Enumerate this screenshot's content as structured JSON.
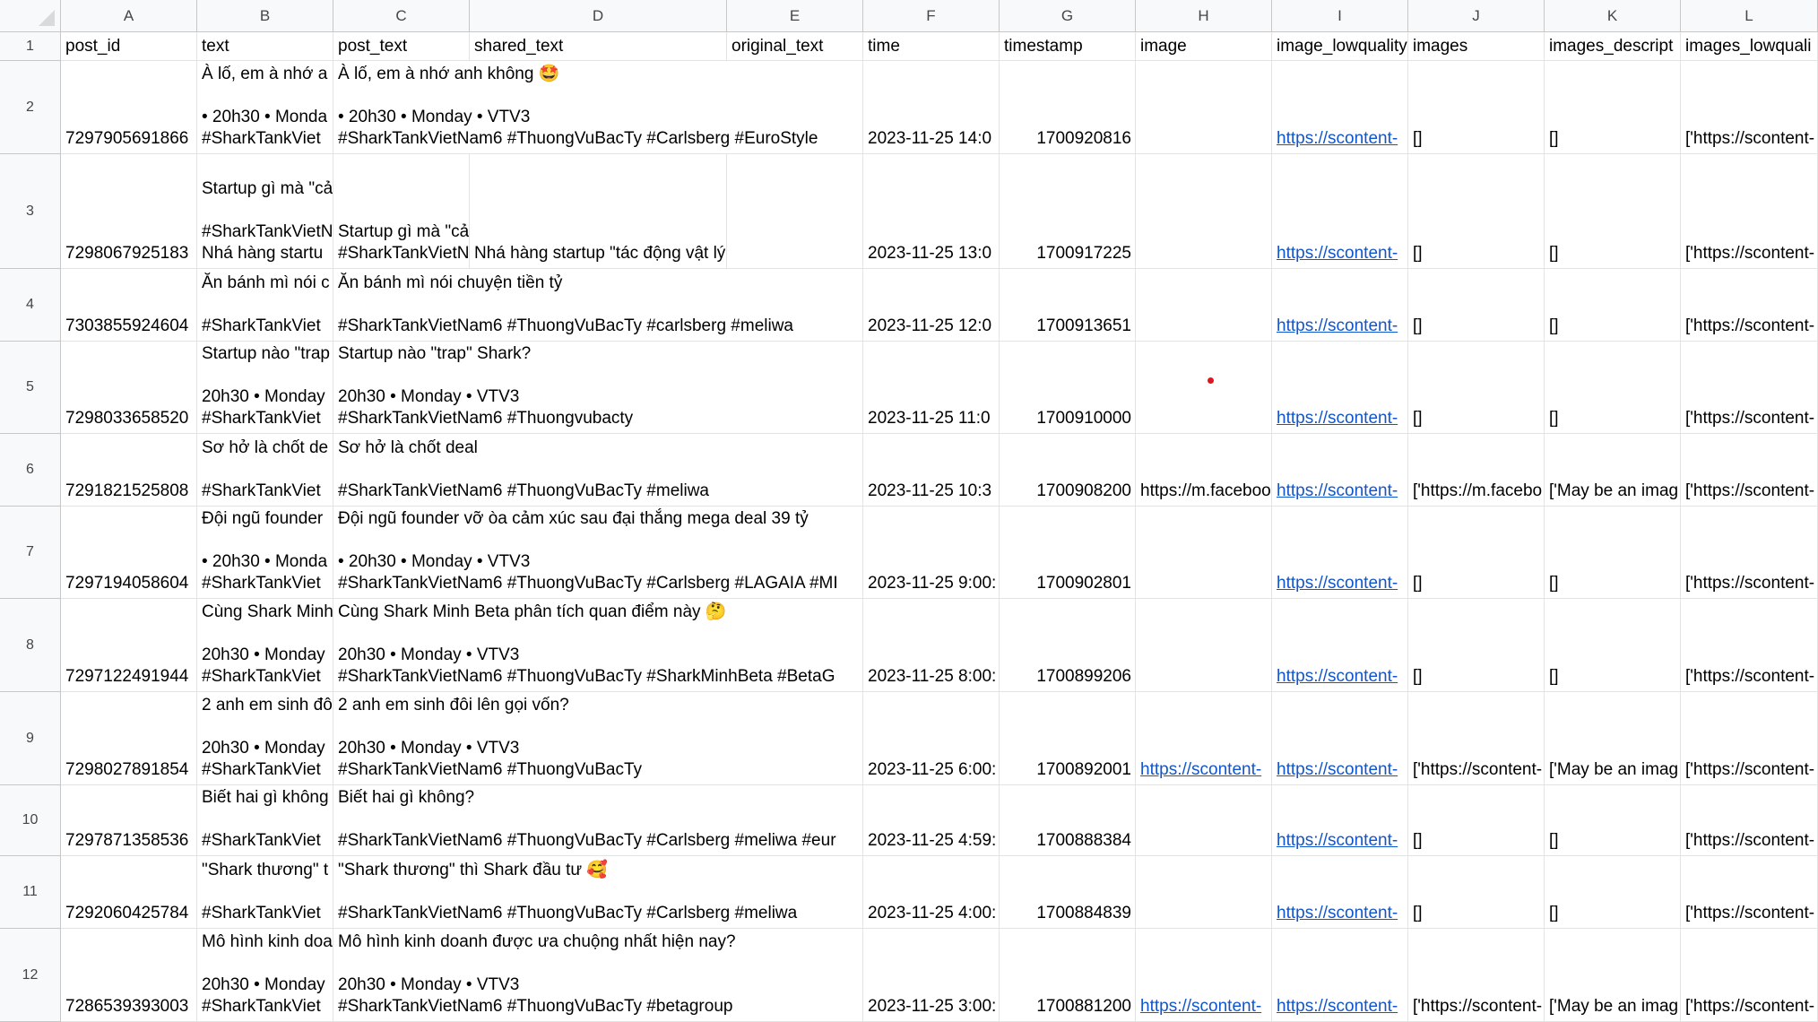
{
  "columns": [
    "A",
    "B",
    "C",
    "D",
    "E",
    "F",
    "G",
    "H",
    "I",
    "J",
    "K",
    "L"
  ],
  "header_row_number": "1",
  "headers": [
    "post_id",
    "text",
    "post_text",
    "shared_text",
    "original_text",
    "time",
    "timestamp",
    "image",
    "image_lowquality",
    "images",
    "images_descript",
    "images_lowquali"
  ],
  "rows": [
    {
      "num": "2",
      "post_id": "7297905691866",
      "text": "À lố, em à nhớ a\n\n• 20h30 • Monda\n#SharkTankViet",
      "post_text": "À lố, em à nhớ anh không 🤩\n\n• 20h30 • Monday • VTV3\n#SharkTankVietNam6 #ThuongVuBacTy #Carlsberg #EuroStyle",
      "shared_text": "",
      "original_text": "",
      "time": "2023-11-25 14:0",
      "timestamp": "1700920816",
      "image": "",
      "image_lowquality": "https://scontent-",
      "images": "[]",
      "images_descript": "[]",
      "images_lowquali": "['https://scontent-"
    },
    {
      "num": "3",
      "post_id": "7298067925183",
      "text": "Startup gì mà \"cả\n\n#SharkTankVietN\nNhá hàng startu",
      "post_text": "\n\nStartup gì mà \"cả\n#SharkTankVietN",
      "shared_text": "Nhá hàng startup \"tác động vật lý\" ngay tại trườn",
      "original_text": "",
      "time": "2023-11-25 13:0",
      "timestamp": "1700917225",
      "image": "",
      "image_lowquality": "https://scontent-",
      "images": "[]",
      "images_descript": "[]",
      "images_lowquali": "['https://scontent-"
    },
    {
      "num": "4",
      "post_id": "7303855924604",
      "text": "Ăn bánh mì nói c\n\n#SharkTankViet",
      "post_text": "Ăn bánh mì nói chuyện tiền tỷ\n\n#SharkTankVietNam6 #ThuongVuBacTy #carlsberg #meliwa",
      "shared_text": "",
      "original_text": "",
      "time": "2023-11-25 12:0",
      "timestamp": "1700913651",
      "image": "",
      "image_lowquality": "https://scontent-",
      "images": "[]",
      "images_descript": "[]",
      "images_lowquali": "['https://scontent-"
    },
    {
      "num": "5",
      "post_id": "7298033658520",
      "text": "Startup nào \"trap\n\n20h30 • Monday\n#SharkTankViet",
      "post_text": "Startup nào \"trap\" Shark?\n\n20h30 • Monday • VTV3\n#SharkTankVietNam6 #Thuongvubacty",
      "shared_text": "",
      "original_text": "",
      "time": "2023-11-25 11:0",
      "timestamp": "1700910000",
      "image": "",
      "image_lowquality": "https://scontent-",
      "images": "[]",
      "images_descript": "[]",
      "images_lowquali": "['https://scontent-"
    },
    {
      "num": "6",
      "post_id": "7291821525808",
      "text": "Sơ hở là chốt de\n\n#SharkTankViet",
      "post_text": "Sơ hở là chốt deal\n\n#SharkTankVietNam6 #ThuongVuBacTy #meliwa",
      "shared_text": "",
      "original_text": "",
      "time": "2023-11-25 10:3",
      "timestamp": "1700908200",
      "image": "https://m.faceboo",
      "image_lowquality": "https://scontent-",
      "images": "['https://m.facebo",
      "images_descript": "['May be an imag",
      "images_lowquali": "['https://scontent-"
    },
    {
      "num": "7",
      "post_id": "7297194058604",
      "text": "Đội ngũ founder\n\n• 20h30 • Monda\n#SharkTankViet",
      "post_text": "Đội ngũ founder vỡ òa cảm xúc sau đại thắng mega deal 39 tỷ\n\n• 20h30 • Monday • VTV3\n#SharkTankVietNam6 #ThuongVuBacTy #Carlsberg #LAGAIA #MI",
      "shared_text": "",
      "original_text": "",
      "time": "2023-11-25 9:00:",
      "timestamp": "1700902801",
      "image": "",
      "image_lowquality": "https://scontent-",
      "images": "[]",
      "images_descript": "[]",
      "images_lowquali": "['https://scontent-"
    },
    {
      "num": "8",
      "post_id": "7297122491944",
      "text": "Cùng Shark Minh\n\n20h30 • Monday\n#SharkTankViet",
      "post_text": "Cùng Shark Minh Beta phân tích quan điểm này 🤔\n\n20h30 • Monday • VTV3\n#SharkTankVietNam6 #ThuongVuBacTy #SharkMinhBeta #BetaG",
      "shared_text": "",
      "original_text": "",
      "time": "2023-11-25 8:00:",
      "timestamp": "1700899206",
      "image": "",
      "image_lowquality": "https://scontent-",
      "images": "[]",
      "images_descript": "[]",
      "images_lowquali": "['https://scontent-"
    },
    {
      "num": "9",
      "post_id": "7298027891854",
      "text": "2 anh em sinh đô\n\n20h30 • Monday\n#SharkTankViet",
      "post_text": "2 anh em sinh đôi lên gọi vốn?\n\n20h30 • Monday • VTV3\n#SharkTankVietNam6 #ThuongVuBacTy",
      "shared_text": "",
      "original_text": "",
      "time": "2023-11-25 6:00:",
      "timestamp": "1700892001",
      "image": "https://scontent-",
      "image_lowquality": "https://scontent-",
      "images": "['https://scontent-",
      "images_descript": "['May be an imag",
      "images_lowquali": "['https://scontent-"
    },
    {
      "num": "10",
      "post_id": "7297871358536",
      "text": "Biết hai gì không\n\n#SharkTankViet",
      "post_text": "Biết hai gì không?\n\n#SharkTankVietNam6 #ThuongVuBacTy #Carlsberg #meliwa #eur",
      "shared_text": "",
      "original_text": "",
      "time": "2023-11-25 4:59:",
      "timestamp": "1700888384",
      "image": "",
      "image_lowquality": "https://scontent-",
      "images": "[]",
      "images_descript": "[]",
      "images_lowquali": "['https://scontent-"
    },
    {
      "num": "11",
      "post_id": "7292060425784",
      "text": "\"Shark thương\" t\n\n#SharkTankViet",
      "post_text": "\"Shark thương\" thì Shark đầu tư 🥰\n\n#SharkTankVietNam6 #ThuongVuBacTy #Carlsberg #meliwa",
      "shared_text": "",
      "original_text": "",
      "time": "2023-11-25 4:00:",
      "timestamp": "1700884839",
      "image": "",
      "image_lowquality": "https://scontent-",
      "images": "[]",
      "images_descript": "[]",
      "images_lowquali": "['https://scontent-"
    },
    {
      "num": "12",
      "post_id": "7286539393003",
      "text": "Mô hình kinh doa\n\n20h30 • Monday\n#SharkTankViet",
      "post_text": "Mô hình kinh doanh được ưa chuộng nhất hiện nay?\n\n20h30 • Monday • VTV3\n#SharkTankVietNam6 #ThuongVuBacTy #betagroup",
      "shared_text": "",
      "original_text": "",
      "time": "2023-11-25 3:00:",
      "timestamp": "1700881200",
      "image": "https://scontent-",
      "image_lowquality": "https://scontent-",
      "images": "['https://scontent-",
      "images_descript": "['May be an imag",
      "images_lowquali": "['https://scontent-"
    }
  ]
}
